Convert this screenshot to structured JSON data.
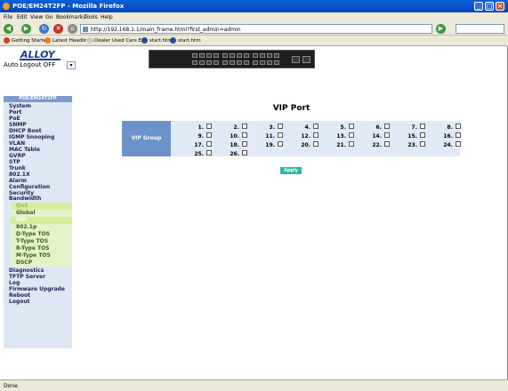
{
  "window": {
    "title": "POE/EM24T2FP - Mozilla Firefox"
  },
  "menu": [
    "File",
    "Edit",
    "View",
    "Go",
    "Bookmarks",
    "Tools",
    "Help"
  ],
  "address": {
    "url": "http://192.168.1.1/main_frame.html?first_admin=admin"
  },
  "bookmarks": [
    "Getting Started",
    "Latest Headlines",
    "Dealer Used Cars Er...",
    "start.htm",
    "start.htm"
  ],
  "header": {
    "logo": "ALLOY",
    "autologout_label": "Auto Logout",
    "autologout_value": "OFF"
  },
  "sidebar": {
    "title": "POE/EM24T2FP",
    "items": [
      "System",
      "Port",
      "PoE",
      "SNMP",
      "DHCP Boot",
      "IGMP Snooping",
      "VLAN",
      "MAC Table",
      "GVRP",
      "STP",
      "Trunk",
      "802.1X",
      "Alarm",
      "Configuration",
      "Security",
      "Bandwidth"
    ],
    "qos": {
      "header": "QoS",
      "subitems": [
        "Global",
        "VIP",
        "802.1p",
        "D-Type TOS",
        "T-Type TOS",
        "R-Type TOS",
        "M-Type TOS",
        "DSCP"
      ]
    },
    "items_after": [
      "Diagnostics",
      "TFTP Server",
      "Log",
      "Firmware Upgrade",
      "Reboot",
      "Logout"
    ]
  },
  "main": {
    "title": "VIP Port",
    "group_label": "VIP Group",
    "ports": [
      "1.",
      "2.",
      "3.",
      "4.",
      "5.",
      "6.",
      "7.",
      "8.",
      "9.",
      "10.",
      "11.",
      "12.",
      "13.",
      "14.",
      "15.",
      "16.",
      "17.",
      "18.",
      "19.",
      "20.",
      "21.",
      "22.",
      "23.",
      "24.",
      "25.",
      "26."
    ],
    "apply_label": "Apply"
  },
  "status": {
    "text": "Done"
  }
}
